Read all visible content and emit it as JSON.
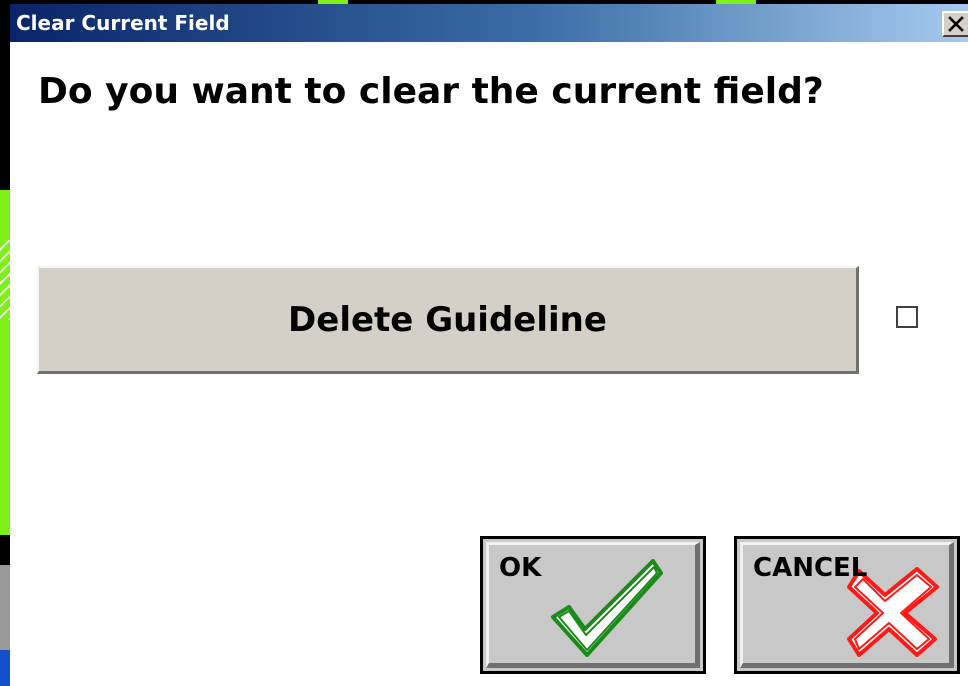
{
  "window": {
    "title": "Clear Current Field",
    "close_symbol": "✕"
  },
  "dialog": {
    "question": "Do you want to clear the current field?",
    "delete_button_label": "Delete Guideline",
    "checkbox_checked": false,
    "ok_label": "OK",
    "cancel_label": "CANCEL"
  },
  "icons": {
    "ok": "checkmark-icon",
    "cancel": "cross-icon",
    "close": "close-icon"
  },
  "colors": {
    "title_bar_start": "#0a246a",
    "title_bar_end": "#a6caf0",
    "button_face": "#d4d0c8",
    "ok_check": "#1a8a1a",
    "cancel_cross": "#ff1a1a",
    "background_accent": "#7cf018"
  }
}
